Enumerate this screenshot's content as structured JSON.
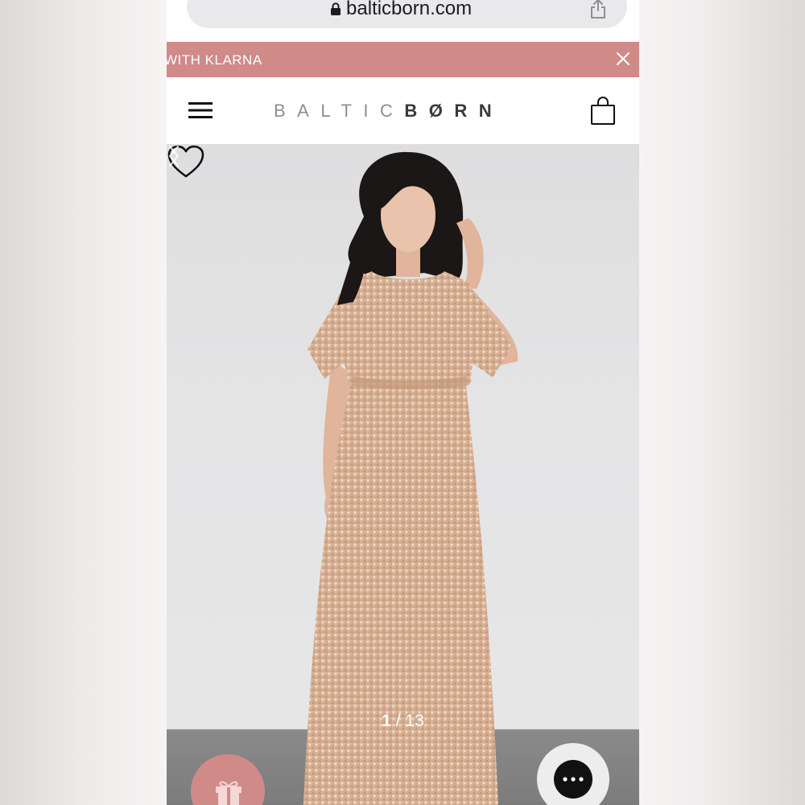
{
  "browser": {
    "url": "balticborn.com",
    "lock_icon": "lock-icon",
    "share_icon": "share-icon"
  },
  "promo_banner": {
    "text": "WITH KLARNA",
    "close_icon": "close-icon",
    "background": "#d08a88"
  },
  "header": {
    "menu_icon": "hamburger-menu-icon",
    "logo_light": "BALTIC",
    "logo_dark": "BØRN",
    "cart_icon": "shopping-bag-icon"
  },
  "product": {
    "favorite_icon": "heart-icon",
    "image_description_icon": "product-photo",
    "pager": {
      "current": "1",
      "separator": " / ",
      "total": "13"
    }
  },
  "floating": {
    "gift_icon": "gift-icon",
    "chat_icon": "chat-dots-icon"
  },
  "colors": {
    "accent": "#d08a88",
    "dress": "#d9b49a",
    "hair": "#1a1716"
  }
}
